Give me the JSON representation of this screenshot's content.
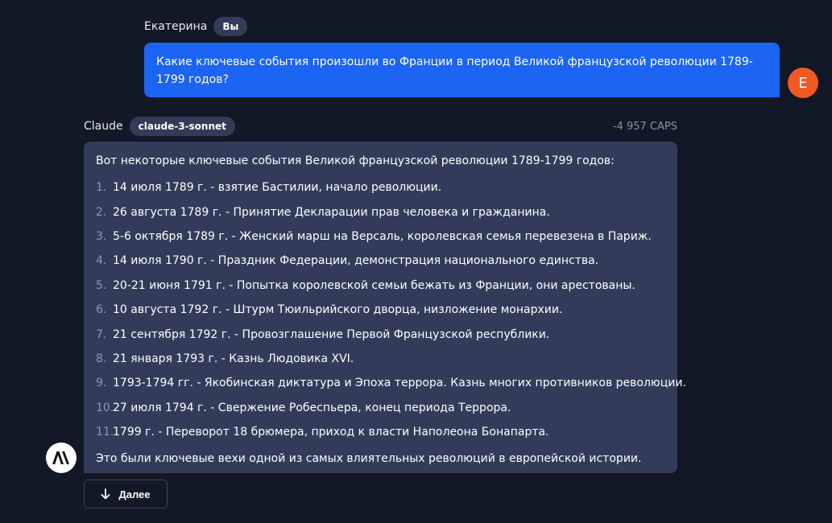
{
  "user_message": {
    "author": "Екатерина",
    "badge": "Вы",
    "text": "Какие ключевые события произошли во Франции в период Великой французской революции 1789-1799 годов?",
    "avatar_letter": "E",
    "avatar_color": "#f05a22"
  },
  "assistant_message": {
    "author": "Claude",
    "model_badge": "claude-3-sonnet",
    "caps": "-4 957 CAPS",
    "intro": "Вот некоторые ключевые события Великой французской революции 1789-1799 годов:",
    "events": [
      {
        "num": "1.",
        "text": "14 июля 1789 г. - взятие Бастилии, начало революции."
      },
      {
        "num": "2.",
        "text": "26 августа 1789 г. - Принятие Декларации прав человека и гражданина."
      },
      {
        "num": "3.",
        "text": "5-6 октября 1789 г. - Женский марш на Версаль, королевская семья перевезена в Париж."
      },
      {
        "num": "4.",
        "text": "14 июля 1790 г. - Праздник Федерации, демонстрация национального единства."
      },
      {
        "num": "5.",
        "text": "20-21 июня 1791 г. - Попытка королевской семьи бежать из Франции, они арестованы."
      },
      {
        "num": "6.",
        "text": "10 августа 1792 г. - Штурм Тюильрийского дворца, низложение монархии."
      },
      {
        "num": "7.",
        "text": "21 сентября 1792 г. - Провозглашение Первой Французской республики."
      },
      {
        "num": "8.",
        "text": "21 января 1793 г. - Казнь Людовика XVI."
      },
      {
        "num": "9.",
        "text": "1793-1794 гг. - Якобинская диктатура и Эпоха террора. Казнь многих противников революции."
      },
      {
        "num": "10.",
        "text": "27 июля 1794 г. - Свержение Робеспьера, конец периода Террора."
      },
      {
        "num": "11.",
        "text": "1799 г. - Переворот 18 брюмера, приход к власти Наполеона Бонапарта."
      }
    ],
    "outro": "Это были ключевые вехи одной из самых влиятельных революций в европейской истории.",
    "avatar_icon": "anthropic-logo-icon"
  },
  "more_button": {
    "label": "Далее",
    "icon": "arrow-down-icon"
  },
  "colors": {
    "background": "#131826",
    "user_bubble": "#1c64f2",
    "assistant_bubble": "#323c5a",
    "badge": "#323c58"
  }
}
